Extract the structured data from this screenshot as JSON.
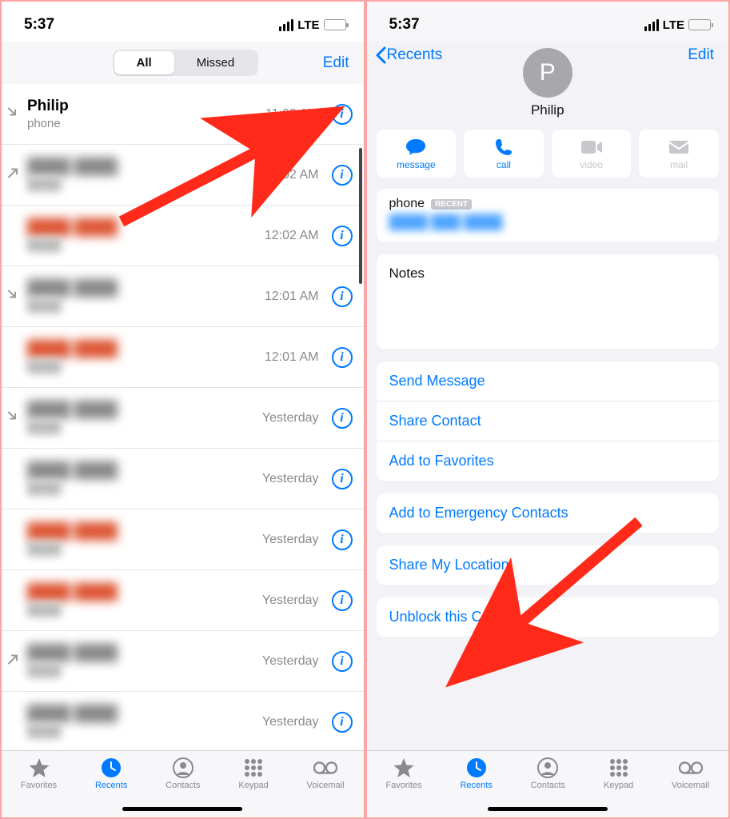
{
  "status": {
    "time": "5:37",
    "network": "LTE"
  },
  "left": {
    "segment": {
      "all": "All",
      "missed": "Missed"
    },
    "edit": "Edit",
    "first_call": {
      "name": "Philip",
      "sub": "phone",
      "time": "11:03 AM"
    },
    "calls": [
      {
        "time": "12:02 AM",
        "red": false,
        "icon": "outgoing"
      },
      {
        "time": "12:02 AM",
        "red": true,
        "icon": ""
      },
      {
        "time": "12:01 AM",
        "red": false,
        "icon": "incoming"
      },
      {
        "time": "12:01 AM",
        "red": true,
        "icon": ""
      },
      {
        "time": "Yesterday",
        "red": false,
        "icon": "incoming"
      },
      {
        "time": "Yesterday",
        "red": false,
        "icon": ""
      },
      {
        "time": "Yesterday",
        "red": true,
        "icon": ""
      },
      {
        "time": "Yesterday",
        "red": true,
        "icon": ""
      },
      {
        "time": "Yesterday",
        "red": false,
        "icon": "outgoing"
      },
      {
        "time": "Yesterday",
        "red": false,
        "icon": ""
      }
    ]
  },
  "right": {
    "back": "Recents",
    "edit": "Edit",
    "avatar_initial": "P",
    "name": "Philip",
    "actions": {
      "message": "message",
      "call": "call",
      "video": "video",
      "mail": "mail"
    },
    "phone_label": "phone",
    "recent_tag": "RECENT",
    "notes_label": "Notes",
    "rows": {
      "send_message": "Send Message",
      "share_contact": "Share Contact",
      "add_favorites": "Add to Favorites",
      "add_emergency": "Add to Emergency Contacts",
      "share_location": "Share My Location",
      "unblock": "Unblock this Caller"
    }
  },
  "tabs": {
    "favorites": "Favorites",
    "recents": "Recents",
    "contacts": "Contacts",
    "keypad": "Keypad",
    "voicemail": "Voicemail"
  }
}
